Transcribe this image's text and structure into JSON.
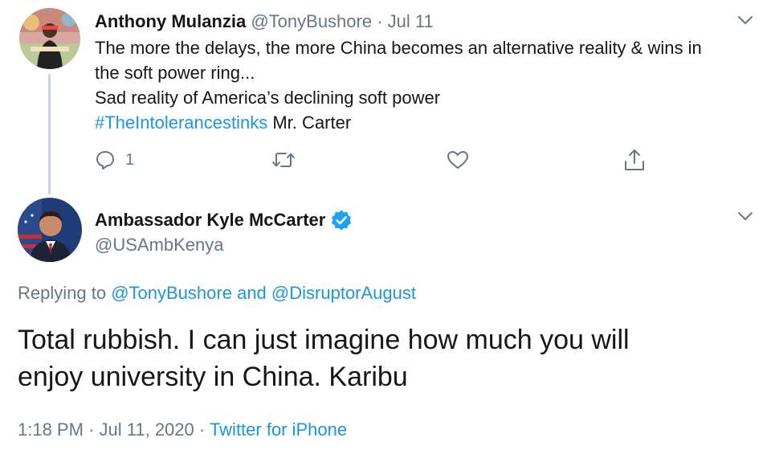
{
  "reply_tweet": {
    "display_name": "Anthony Mulanzia",
    "handle": "@TonyBushore",
    "separator": "·",
    "date": "Jul 11",
    "lines": [
      "The more the delays, the more China becomes an alternative reality & wins in",
      "the soft power ring...",
      "Sad reality of America’s declining soft power"
    ],
    "hashtag": "#TheIntolerancestinks",
    "tail": "Mr. Carter",
    "actions": {
      "reply_count": "1"
    },
    "icons": [
      "reply-icon",
      "retweet-icon",
      "like-icon",
      "share-icon",
      "chevron-down-icon"
    ]
  },
  "main_tweet": {
    "display_name": "Ambassador Kyle McCarter",
    "handle": "@USAmbKenya",
    "verified": true,
    "replying_prefix": "Replying to",
    "replying_user1": "@TonyBushore",
    "replying_and": "and",
    "replying_user2": "@DisruptorAugust",
    "text_lines": [
      "Total rubbish. I can just imagine how much you will",
      "enjoy university in China. Karibu"
    ],
    "time": "1:18 PM",
    "separator": "·",
    "date": "Jul 11, 2020",
    "source": "Twitter for iPhone"
  },
  "colors": {
    "link": "#1b95e0",
    "secondary_text": "#657786",
    "primary_text": "#14171a",
    "verified": "#1da1f2"
  }
}
